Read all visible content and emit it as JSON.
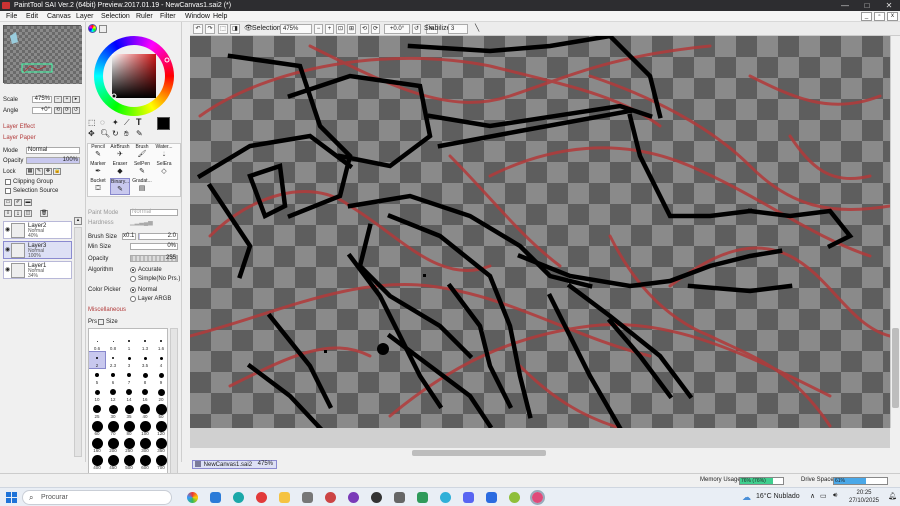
{
  "app": {
    "title": "PaintTool SAI Ver.2 (64bit) Preview.2017.01.19 - NewCanvas1.sai2 (*)",
    "minimize": "—",
    "maximize": "□",
    "close": "✕"
  },
  "menu": {
    "items": [
      "File",
      "Edit",
      "Canvas",
      "Layer",
      "Selection",
      "Ruler",
      "Filter",
      "Window",
      "Help"
    ]
  },
  "toolbar": {
    "selection_label": "Selection",
    "zoom_value": "475%",
    "zoom_minus": "−",
    "zoom_plus": "+",
    "rotate_value": "+0.0°",
    "stabilizer_label": "Stabilizer",
    "stabilizer_value": "3"
  },
  "navigator": {
    "scale_label": "Scale",
    "scale_value": "475%",
    "angle_label": "Angle",
    "angle_value": "+0°"
  },
  "layer_panel": {
    "layer_effect": "Layer Effect",
    "layer_paper": "Layer Paper",
    "mode_label": "Mode",
    "mode_value": "Normal",
    "opacity_label": "Opacity",
    "opacity_value": "100%",
    "lock_label": "Lock",
    "clipping_group": "Clipping Group",
    "selection_source": "Selection Source",
    "layers": [
      {
        "name": "Layer2",
        "mode": "Normal",
        "opacity": "40%",
        "selected": false
      },
      {
        "name": "Layer3",
        "mode": "Normal",
        "opacity": "100%",
        "selected": true
      },
      {
        "name": "Layer1",
        "mode": "Normal",
        "opacity": "34%",
        "selected": false
      }
    ]
  },
  "tools": {
    "brush_tools": [
      {
        "label": "Pencil",
        "icon": "pencil-icon"
      },
      {
        "label": "AirBrush",
        "icon": "airbrush-icon"
      },
      {
        "label": "Brush",
        "icon": "brush-icon"
      },
      {
        "label": "Water...",
        "icon": "water-icon"
      },
      {
        "label": "Marker",
        "icon": "marker-icon"
      },
      {
        "label": "Eraser",
        "icon": "eraser-icon"
      },
      {
        "label": "SelPen",
        "icon": "selpen-icon"
      },
      {
        "label": "SelEra",
        "icon": "selera-icon"
      },
      {
        "label": "Bucket",
        "icon": "bucket-icon"
      },
      {
        "label": "Binary...",
        "icon": "binary-icon"
      },
      {
        "label": "Gradat...",
        "icon": "gradient-icon"
      }
    ],
    "paint_mode_label": "Paint Mode",
    "paint_mode_value": "Normal",
    "hardness_label": "Hardness",
    "brush_size_label": "Brush Size",
    "brush_size_mult": "x0.1",
    "brush_size_value": "2.0",
    "min_size_label": "Min Size",
    "min_size_value": "0%",
    "opacity_label": "Opacity",
    "opacity_value": "255",
    "algorithm_label": "Algorithm",
    "algorithm_accurate": "Accurate",
    "algorithm_simple": "Simple(No Prs.)",
    "color_picker_label": "Color Picker",
    "color_picker_normal": "Normal",
    "color_picker_argb": "Layer ARGB",
    "misc_label": "Miscellaneous",
    "prs_label": "Prs",
    "size_label": "Size"
  },
  "brush_sizes": [
    "0.6",
    "0.8",
    "1",
    "1.3",
    "1.6",
    "2",
    "2.3",
    "3",
    "3.5",
    "4",
    "5",
    "6",
    "7",
    "8",
    "9",
    "10",
    "12",
    "14",
    "16",
    "20",
    "25",
    "30",
    "35",
    "40",
    "50",
    "60",
    "70",
    "80",
    "100",
    "120",
    "160",
    "200",
    "250",
    "300",
    "350",
    "400",
    "450",
    "500",
    "600",
    "700"
  ],
  "document_tab": {
    "name": "NewCanvas1.sai2",
    "zoom": "475%"
  },
  "status": {
    "memory_label": "Memory Usage",
    "memory_value": "76% (76%)",
    "memory_fraction": 0.76,
    "drive_label": "Drive Space",
    "drive_value": "61%",
    "drive_fraction": 0.61
  },
  "taskbar": {
    "search_placeholder": "Procurar",
    "weather": "16°C  Nublado",
    "time": "20:25",
    "date": "27/10/2025"
  },
  "colors": {
    "accent_selected": "#dde0f5",
    "memory_fill": "#3fcf8f",
    "drive_fill": "#4aa8e8",
    "checker_dark": "#5e5e5e",
    "checker_light": "#8a8a8a",
    "sketch_red": "#b33a3a",
    "ink": "#000000"
  }
}
